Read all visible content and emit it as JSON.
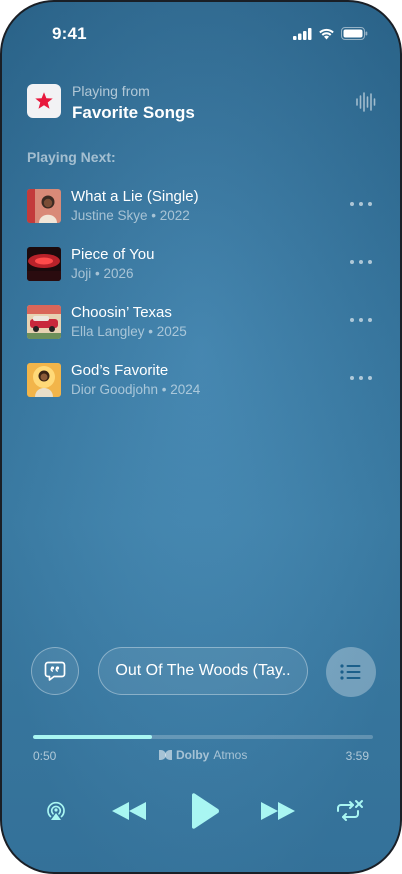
{
  "status_bar": {
    "time": "9:41",
    "signal_icon": "cellular-signal-icon",
    "wifi_icon": "wifi-icon",
    "battery_icon": "battery-icon"
  },
  "header": {
    "playing_from_label": "Playing from",
    "source_name": "Favorite Songs",
    "source_icon": "star-icon",
    "wave_icon": "waveform-icon"
  },
  "queue": {
    "heading": "Playing Next:",
    "items": [
      {
        "title": "What a Lie (Single)",
        "subtitle": "Justine Skye • 2022"
      },
      {
        "title": "Piece of You",
        "subtitle": "Joji • 2026"
      },
      {
        "title": "Choosin’ Texas",
        "subtitle": "Ella Langley • 2025"
      },
      {
        "title": "God’s Favorite",
        "subtitle": "Dior Goodjohn • 2024"
      }
    ]
  },
  "controls": {
    "now_playing_title": "Out Of The Woods (Tay..",
    "lyrics_icon": "lyrics-icon",
    "queue_icon": "list-icon"
  },
  "progress": {
    "elapsed": "0:50",
    "total": "3:59",
    "fraction": 0.35,
    "dolby_prefix": "Dolby",
    "dolby_suffix": "Atmos"
  },
  "transport": {
    "airplay_icon": "airplay-icon",
    "previous_icon": "backward-icon",
    "play_icon": "play-icon",
    "next_icon": "forward-icon",
    "repeat_icon": "repeat-icon"
  },
  "colors": {
    "accent": "#a9f6f2",
    "background": "#3a7fab",
    "star": "#e8173c"
  }
}
